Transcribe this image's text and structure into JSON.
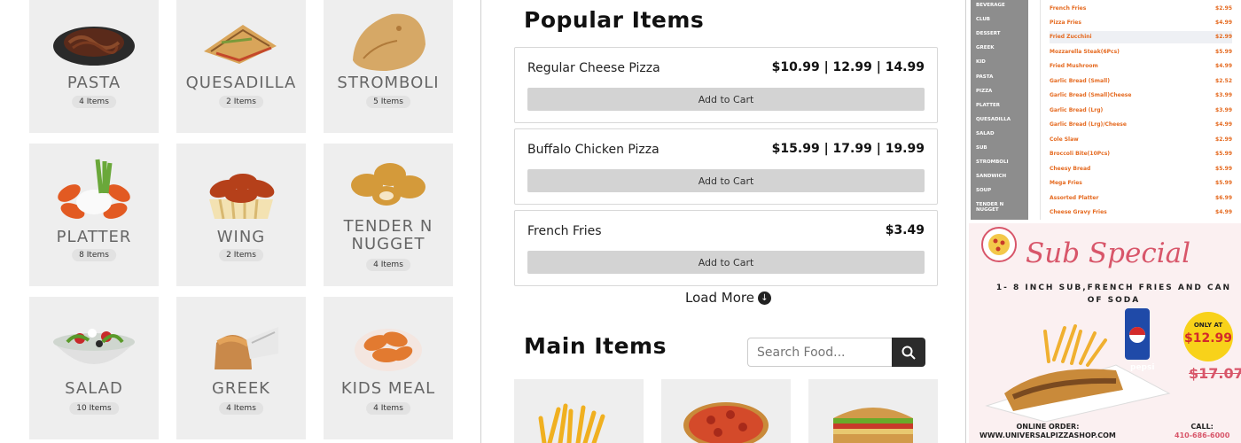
{
  "categories": [
    {
      "name": "PASTA",
      "count": "4 Items",
      "icon": "pasta-image"
    },
    {
      "name": "QUESADILLA",
      "count": "2 Items",
      "icon": "quesadilla-image"
    },
    {
      "name": "STROMBOLI",
      "count": "5 Items",
      "icon": "stromboli-image"
    },
    {
      "name": "PLATTER",
      "count": "8 Items",
      "icon": "platter-image"
    },
    {
      "name": "WING",
      "count": "2 Items",
      "icon": "wing-image"
    },
    {
      "name": "TENDER N NUGGET",
      "count": "4 Items",
      "icon": "nugget-image"
    },
    {
      "name": "SALAD",
      "count": "10 Items",
      "icon": "salad-image"
    },
    {
      "name": "GREEK",
      "count": "4 Items",
      "icon": "greek-image"
    },
    {
      "name": "KIDS MEAL",
      "count": "4 Items",
      "icon": "kids-meal-image"
    }
  ],
  "popular": {
    "title": "Popular Items",
    "items": [
      {
        "name": "Regular Cheese Pizza",
        "price": "$10.99 | 12.99 | 14.99",
        "button": "Add to Cart"
      },
      {
        "name": "Buffalo Chicken Pizza",
        "price": "$15.99 | 17.99 | 19.99",
        "button": "Add to Cart"
      },
      {
        "name": "French Fries",
        "price": "$3.49",
        "button": "Add to Cart"
      }
    ],
    "load_more": "Load More"
  },
  "main": {
    "title": "Main Items",
    "search_placeholder": "Search Food..."
  },
  "menu_sidebar": [
    "BEVERAGE",
    "CLUB",
    "DESSERT",
    "GREEK",
    "KID",
    "PASTA",
    "PIZZA",
    "PLATTER",
    "QUESADILLA",
    "SALAD",
    "SUB",
    "STROMBOLI",
    "SANDWICH",
    "SOUP",
    "TENDER N NUGGET"
  ],
  "menu_items": [
    {
      "name": "French Fries",
      "price": "$2.95"
    },
    {
      "name": "Pizza Fries",
      "price": "$4.99"
    },
    {
      "name": "Fried Zucchini",
      "price": "$2.99"
    },
    {
      "name": "Mozzarella Steak(6Pcs)",
      "price": "$5.99"
    },
    {
      "name": "Fried Mushroom",
      "price": "$4.99"
    },
    {
      "name": "Garlic Bread (Small)",
      "price": "$2.52"
    },
    {
      "name": "Garlic Bread (Small)Cheese",
      "price": "$3.99"
    },
    {
      "name": "Garlic Bread (Lrg)",
      "price": "$3.99"
    },
    {
      "name": "Garlic Bread (Lrg)/Cheese",
      "price": "$4.99"
    },
    {
      "name": "Cole Slaw",
      "price": "$2.99"
    },
    {
      "name": "Broccoli Bite(10Pcs)",
      "price": "$5.99"
    },
    {
      "name": "Cheesy Bread",
      "price": "$5.99"
    },
    {
      "name": "Mega Fries",
      "price": "$5.99"
    },
    {
      "name": "Assorted Platter",
      "price": "$6.99"
    },
    {
      "name": "Cheese Gravy Fries",
      "price": "$4.99"
    }
  ],
  "promo": {
    "title": "Sub Special",
    "description": "1- 8 INCH SUB,FRENCH FRIES AND CAN OF SODA",
    "badge_only": "ONLY AT",
    "badge_price": "$12.99",
    "old_price": "$17.07",
    "order_label": "ONLINE ORDER:",
    "order_url": "WWW.UNIVERSALPIZZASHOP.COM",
    "call_label": "CALL:",
    "call_number": "410-686-6000",
    "can_brand": "pepsi"
  },
  "colors": {
    "accent_orange": "#e56a20",
    "promo_pink": "#d8566a",
    "card_gray": "#eeeeee",
    "button_gray": "#d3d3d3"
  }
}
